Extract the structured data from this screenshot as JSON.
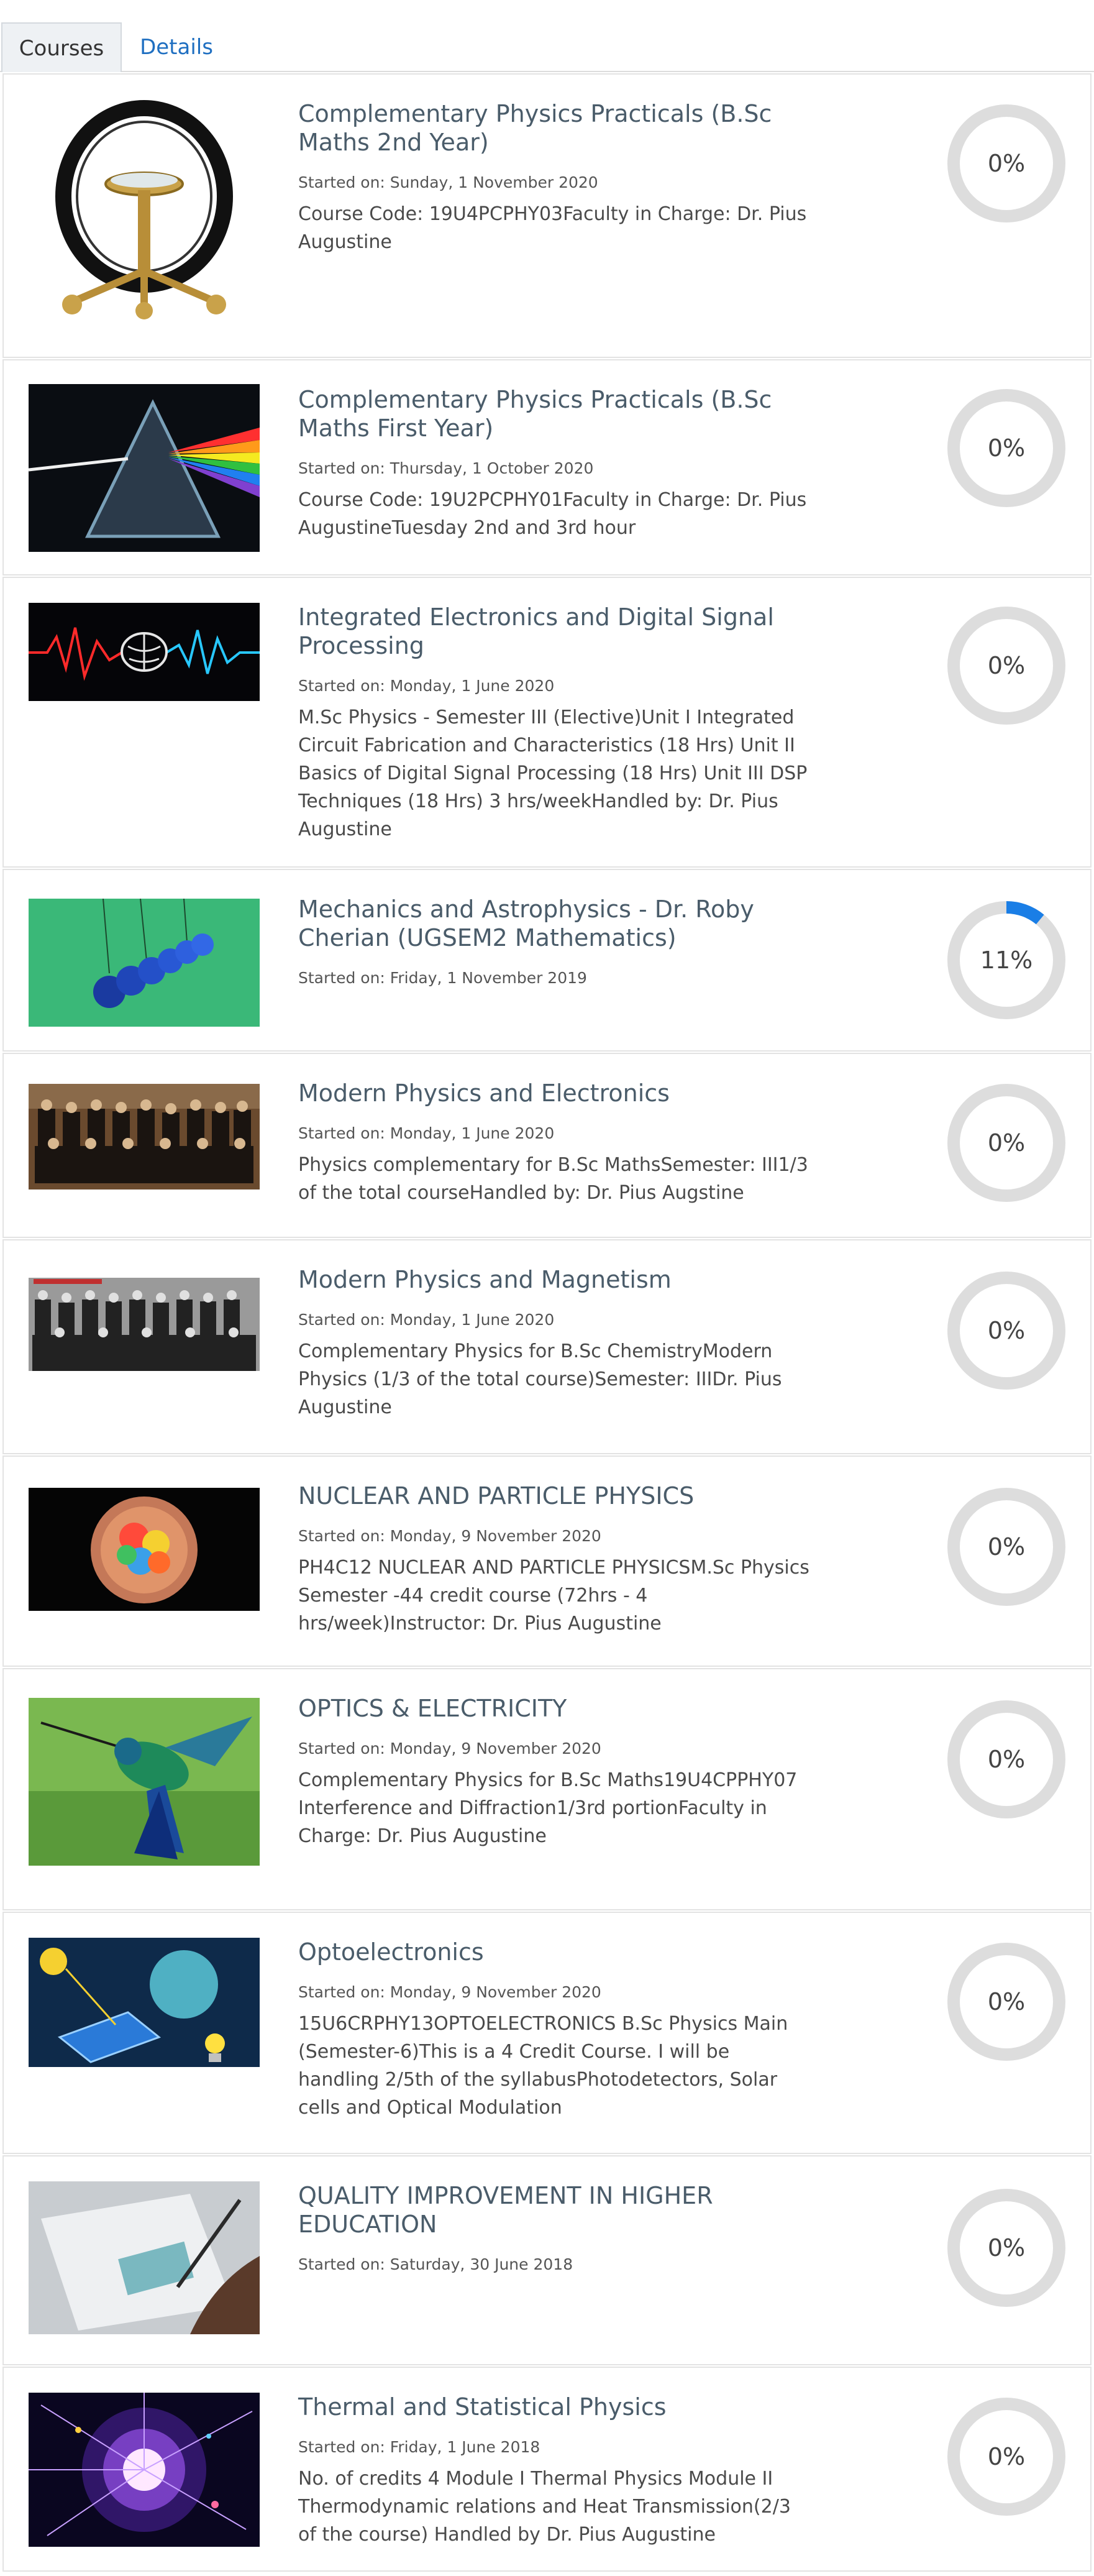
{
  "tabs": [
    {
      "label": "Courses"
    },
    {
      "label": "Details"
    }
  ],
  "courses": [
    {
      "title": "Complementary Physics Practicals (B.Sc Maths 2nd Year)",
      "started": "Started on: Sunday, 1 November 2020",
      "summary": "Course Code: 19U4PCPHY03Faculty in Charge: Dr. Pius Augustine",
      "progress_label": "0%",
      "progress": 0
    },
    {
      "title": "Complementary Physics Practicals (B.Sc Maths First Year)",
      "started": "Started on: Thursday, 1 October 2020",
      "summary": "Course Code:  19U2PCPHY01Faculty in Charge: Dr. Pius AugustineTuesday 2nd and 3rd hour",
      "progress_label": "0%",
      "progress": 0
    },
    {
      "title": "Integrated Electronics and Digital Signal Processing",
      "started": "Started on: Monday, 1 June 2020",
      "summary": "M.Sc Physics - Semester III (Elective)Unit I  Integrated Circuit Fabrication and Characteristics (18 Hrs) Unit II  Basics of Digital Signal Processing (18 Hrs) Unit III  DSP Techniques (18 Hrs) 3 hrs/weekHandled by: Dr. Pius Augustine",
      "progress_label": "0%",
      "progress": 0
    },
    {
      "title": "Mechanics and Astrophysics - Dr. Roby Cherian (UGSEM2 Mathematics)",
      "started": "Started on: Friday, 1 November 2019",
      "summary": "",
      "progress_label": "11%",
      "progress": 11
    },
    {
      "title": "Modern Physics and Electronics",
      "started": "Started on: Monday, 1 June 2020",
      "summary": "Physics complementary for B.Sc MathsSemester: III1/3 of the total courseHandled by: Dr. Pius Augstine",
      "progress_label": "0%",
      "progress": 0
    },
    {
      "title": "Modern Physics and Magnetism",
      "started": "Started on: Monday, 1 June 2020",
      "summary": "Complementary Physics for B.Sc ChemistryModern Physics (1/3 of the total course)Semester: IIIDr. Pius Augustine",
      "progress_label": "0%",
      "progress": 0
    },
    {
      "title": "NUCLEAR AND PARTICLE PHYSICS",
      "started": "Started on: Monday, 9 November 2020",
      "summary": "PH4C12       NUCLEAR AND PARTICLE PHYSICSM.Sc Physics Semester -44 credit course (72hrs - 4 hrs/week)Instructor: Dr. Pius Augustine",
      "progress_label": "0%",
      "progress": 0
    },
    {
      "title": "OPTICS & ELECTRICITY",
      "started": "Started on: Monday, 9 November 2020",
      "summary": "Complementary Physics for B.Sc Maths19U4CPPHY07 Interference and Diffraction1/3rd portionFaculty in Charge: Dr. Pius Augustine",
      "progress_label": "0%",
      "progress": 0
    },
    {
      "title": "Optoelectronics",
      "started": "Started on: Monday, 9 November 2020",
      "summary": "15U6CRPHY13OPTOELECTRONICS B.Sc Physics Main (Semester-6)This is a 4 Credit Course.  I will be handling 2/5th of the syllabusPhotodetectors, Solar cells and Optical Modulation",
      "progress_label": "0%",
      "progress": 0
    },
    {
      "title": "QUALITY IMPROVEMENT IN HIGHER EDUCATION",
      "started": "Started on: Saturday, 30 June 2018",
      "summary": "",
      "progress_label": "0%",
      "progress": 0
    },
    {
      "title": "Thermal and Statistical Physics",
      "started": "Started on: Friday, 1 June 2018",
      "summary": "No. of credits 4 Module I   Thermal Physics Module II  Thermodynamic relations and Heat Transmission(2/3 of the course) Handled by Dr. Pius Augustine",
      "progress_label": "0%",
      "progress": 0
    }
  ],
  "colors": {
    "ring_track": "#dddddd",
    "ring_fill": "#1a7ee6",
    "title": "#4a5c6a",
    "tab_link": "#1f6fc1"
  }
}
